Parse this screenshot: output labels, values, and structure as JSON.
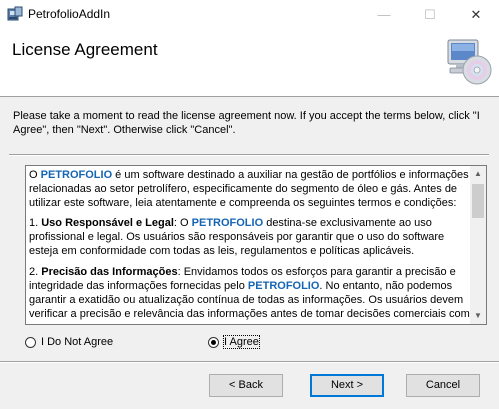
{
  "window": {
    "title": "PetrofolioAddIn",
    "minimize_glyph": "—",
    "maximize_glyph": "☐",
    "close_glyph": "✕"
  },
  "header": {
    "title": "License Agreement",
    "icon": "computer-cd-icon"
  },
  "intro": "Please take a moment to read the license agreement now. If you accept the terms below, click \"I Agree\", then \"Next\". Otherwise click \"Cancel\".",
  "license": {
    "p1_prefix": "O ",
    "brand": "PETROFOLIO",
    "p1_rest": " é um software destinado a auxiliar na gestão de portfólios e informações relacionadas ao setor petrolífero, especificamente do segmento de óleo e gás. Antes de utilizar este software, leia atentamente e compreenda os seguintes termos e condições:",
    "p2_num": "1. ",
    "p2_heading": "Uso Responsável e Legal",
    "p2_mid": ": O ",
    "p2_rest": " destina-se exclusivamente ao uso profissional e legal. Os usuários são responsáveis por garantir que o uso do software esteja em conformidade com todas as leis, regulamentos e políticas aplicáveis.",
    "p3_num": "2. ",
    "p3_heading": "Precisão das Informações",
    "p3_a": ": Envidamos todos os esforços para garantir a precisão e integridade das informações fornecidas pelo ",
    "p3_b": ". No entanto, não podemos garantir a exatidão ou atualização contínua de todas as informações. Os usuários devem verificar a precisão e relevância das informações antes de tomar decisões comerciais com"
  },
  "options": {
    "disagree_label": "I Do Not Agree",
    "agree_label": "I Agree",
    "selected": "agree"
  },
  "buttons": {
    "back": "< Back",
    "next": "Next >",
    "cancel": "Cancel"
  },
  "scrollbar": {
    "up_glyph": "▲",
    "down_glyph": "▼"
  }
}
